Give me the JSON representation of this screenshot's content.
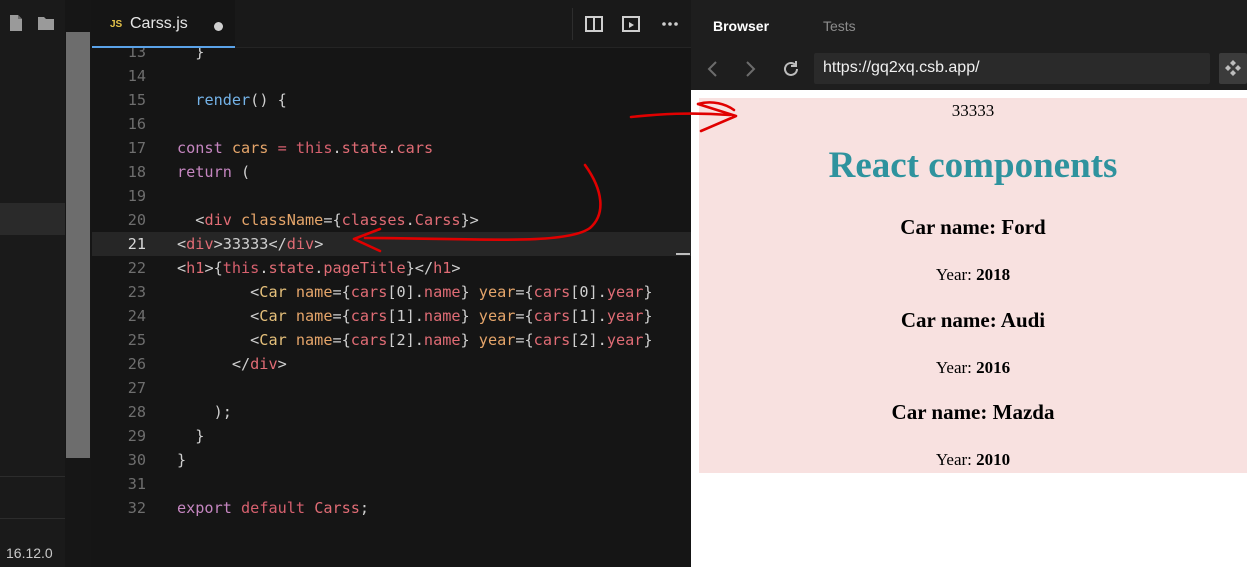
{
  "sidebar": {
    "version": "16.12.0"
  },
  "editor": {
    "tab": {
      "lang_badge": "JS",
      "file_name": "Carss.js"
    },
    "lines": [
      {
        "n": "13",
        "tokens": [
          [
            "pl",
            "  }"
          ]
        ]
      },
      {
        "n": "14",
        "tokens": []
      },
      {
        "n": "15",
        "tokens": [
          [
            "pl",
            "  "
          ],
          [
            "fn",
            "render"
          ],
          [
            "pl",
            "() {"
          ]
        ]
      },
      {
        "n": "16",
        "tokens": []
      },
      {
        "n": "17",
        "tokens": [
          [
            "kw",
            "const"
          ],
          [
            "pl",
            " "
          ],
          [
            "attr",
            "cars"
          ],
          [
            "pl",
            " "
          ],
          [
            "kw2",
            "="
          ],
          [
            "pl",
            " "
          ],
          [
            "kw2",
            "this"
          ],
          [
            "pl",
            "."
          ],
          [
            "prop",
            "state"
          ],
          [
            "pl",
            "."
          ],
          [
            "prop",
            "cars"
          ]
        ]
      },
      {
        "n": "18",
        "tokens": [
          [
            "kw",
            "return"
          ],
          [
            "pl",
            " ("
          ]
        ]
      },
      {
        "n": "19",
        "tokens": []
      },
      {
        "n": "20",
        "tokens": [
          [
            "pl",
            "  <"
          ],
          [
            "tag",
            "div"
          ],
          [
            "pl",
            " "
          ],
          [
            "attr",
            "className"
          ],
          [
            "pl",
            "={"
          ],
          [
            "prop",
            "classes"
          ],
          [
            "pl",
            "."
          ],
          [
            "prop",
            "Carss"
          ],
          [
            "pl",
            "}>"
          ]
        ]
      },
      {
        "n": "21",
        "tokens": [
          [
            "pl",
            "<"
          ],
          [
            "tag",
            "div"
          ],
          [
            "pl",
            ">33333</"
          ],
          [
            "tag",
            "div"
          ],
          [
            "pl",
            ">"
          ]
        ],
        "active": true
      },
      {
        "n": "22",
        "tokens": [
          [
            "pl",
            "<"
          ],
          [
            "tag",
            "h1"
          ],
          [
            "pl",
            ">{"
          ],
          [
            "kw2",
            "this"
          ],
          [
            "pl",
            "."
          ],
          [
            "prop",
            "state"
          ],
          [
            "pl",
            "."
          ],
          [
            "prop",
            "pageTitle"
          ],
          [
            "pl",
            "}</"
          ],
          [
            "tag",
            "h1"
          ],
          [
            "pl",
            ">"
          ]
        ]
      },
      {
        "n": "23",
        "tokens": [
          [
            "pl",
            "        <"
          ],
          [
            "comp",
            "Car"
          ],
          [
            "pl",
            " "
          ],
          [
            "attr",
            "name"
          ],
          [
            "pl",
            "={"
          ],
          [
            "prop",
            "cars"
          ],
          [
            "pl",
            "[0]."
          ],
          [
            "prop",
            "name"
          ],
          [
            "pl",
            "} "
          ],
          [
            "attr",
            "year"
          ],
          [
            "pl",
            "={"
          ],
          [
            "prop",
            "cars"
          ],
          [
            "pl",
            "[0]."
          ],
          [
            "prop",
            "year"
          ],
          [
            "pl",
            "}"
          ]
        ]
      },
      {
        "n": "24",
        "tokens": [
          [
            "pl",
            "        <"
          ],
          [
            "comp",
            "Car"
          ],
          [
            "pl",
            " "
          ],
          [
            "attr",
            "name"
          ],
          [
            "pl",
            "={"
          ],
          [
            "prop",
            "cars"
          ],
          [
            "pl",
            "[1]."
          ],
          [
            "prop",
            "name"
          ],
          [
            "pl",
            "} "
          ],
          [
            "attr",
            "year"
          ],
          [
            "pl",
            "={"
          ],
          [
            "prop",
            "cars"
          ],
          [
            "pl",
            "[1]."
          ],
          [
            "prop",
            "year"
          ],
          [
            "pl",
            "}"
          ]
        ]
      },
      {
        "n": "25",
        "tokens": [
          [
            "pl",
            "        <"
          ],
          [
            "comp",
            "Car"
          ],
          [
            "pl",
            " "
          ],
          [
            "attr",
            "name"
          ],
          [
            "pl",
            "={"
          ],
          [
            "prop",
            "cars"
          ],
          [
            "pl",
            "[2]."
          ],
          [
            "prop",
            "name"
          ],
          [
            "pl",
            "} "
          ],
          [
            "attr",
            "year"
          ],
          [
            "pl",
            "={"
          ],
          [
            "prop",
            "cars"
          ],
          [
            "pl",
            "[2]."
          ],
          [
            "prop",
            "year"
          ],
          [
            "pl",
            "}"
          ]
        ]
      },
      {
        "n": "26",
        "tokens": [
          [
            "pl",
            "      </"
          ],
          [
            "tag",
            "div"
          ],
          [
            "pl",
            ">"
          ]
        ]
      },
      {
        "n": "27",
        "tokens": []
      },
      {
        "n": "28",
        "tokens": [
          [
            "pl",
            "    );"
          ]
        ]
      },
      {
        "n": "29",
        "tokens": [
          [
            "pl",
            "  }"
          ]
        ]
      },
      {
        "n": "30",
        "tokens": [
          [
            "pl",
            "}"
          ]
        ]
      },
      {
        "n": "31",
        "tokens": []
      },
      {
        "n": "32",
        "tokens": [
          [
            "kw",
            "export"
          ],
          [
            "pl",
            " "
          ],
          [
            "kw2",
            "default"
          ],
          [
            "pl",
            " "
          ],
          [
            "prop",
            "Carss"
          ],
          [
            "pl",
            ";"
          ]
        ]
      }
    ]
  },
  "browser": {
    "tabs": [
      {
        "label": "Browser",
        "active": true
      },
      {
        "label": "Tests",
        "active": false
      }
    ],
    "url": "https://gq2xq.csb.app/",
    "page": {
      "top_text": "33333",
      "title": "React components",
      "cars": [
        {
          "name_label": "Car name: Ford",
          "year_label": "Year:",
          "year": "2018"
        },
        {
          "name_label": "Car name: Audi",
          "year_label": "Year:",
          "year": "2016"
        },
        {
          "name_label": "Car name: Mazda",
          "year_label": "Year:",
          "year": "2010"
        }
      ]
    }
  },
  "colors": {
    "accent": "#5aa2e8",
    "annotation": "#e00000",
    "title": "#2f939e",
    "app_bg": "#f8e1e0"
  },
  "icons": [
    "file-icon",
    "folder-icon",
    "split-view-icon",
    "preview-icon",
    "more-icon",
    "back-icon",
    "forward-icon",
    "reload-icon",
    "extension-icon"
  ]
}
